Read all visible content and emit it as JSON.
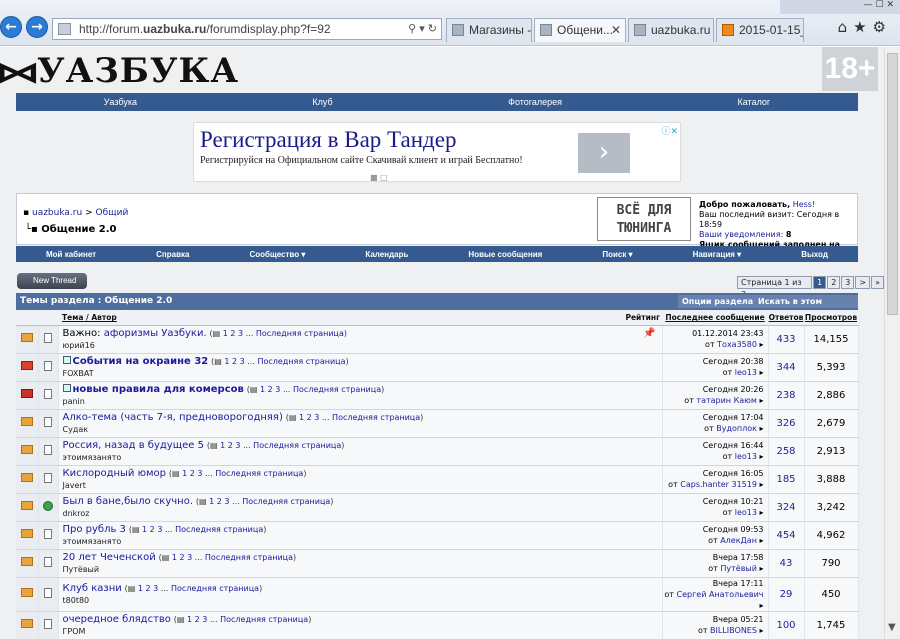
{
  "browser": {
    "url_host_prefix": "http://forum.",
    "url_host": "uazbuka.ru",
    "url_path": "/forumdisplay.php?f=92",
    "tabs": [
      {
        "label": "Магазины -..."
      },
      {
        "label": "Общени..."
      },
      {
        "label": "uazbuka.ru ..."
      },
      {
        "label": "2015-01-15_..."
      }
    ]
  },
  "site": {
    "logo": "УАЗБУКА",
    "age_badge": "18+",
    "top_nav": [
      "Уазбука",
      "Клуб",
      "Фотогалерея",
      "Каталог"
    ]
  },
  "ad": {
    "headline": "Регистрация в Вар Тандер",
    "subline": "Регистрируйся на Официальном сайте Скачивай клиент и играй Бесплатно!",
    "go": "›"
  },
  "breadcrumb": {
    "home": "uazbuka.ru",
    "sep": ">",
    "parent": "Общий",
    "current": "Общение 2.0"
  },
  "side_ad": {
    "line1": "ВСЁ ДЛЯ",
    "line2": "ТЮНИНГА"
  },
  "welcome": {
    "greet": "Добро пожаловать,",
    "user": "Hess!",
    "last_visit": "Ваш последний визит: Сегодня в 18:59",
    "notifications": "Ваши уведомления:",
    "notif_count": "8",
    "inbox": "Ящик сообщений заполнен на 98%."
  },
  "main_nav": [
    "Мой кабинет",
    "Справка",
    "Сообщество ▾",
    "Календарь",
    "Новые сообщения",
    "Поиск ▾",
    "Навигация ▾",
    "Выход"
  ],
  "new_thread": "New Thread",
  "pager": {
    "label": "Страница 1 из 3",
    "pages": [
      "1",
      "2",
      "3"
    ],
    "next": ">",
    "last": "»"
  },
  "section": {
    "title": "Темы раздела : Общение 2.0",
    "options": "Опции раздела ▾",
    "search": "Искать в этом разделе ▾"
  },
  "columns": {
    "title": "Тема",
    "slash": " / ",
    "author": "Автор",
    "rating": "Рейтинг",
    "last_post": "Последнее сообщение",
    "replies": "Ответов",
    "views": "Просмотров"
  },
  "last_page_label": "Последняя страница",
  "threads": [
    {
      "prefix": "Важно: ",
      "title": "афоризмы Уазбуки.",
      "pages": "1 2 3",
      "author": "юрий16",
      "when": "01.12.2014 23:43",
      "by": "Тоха3580",
      "replies": "433",
      "views": "14,155",
      "bold": false,
      "check": false,
      "pinned": true
    },
    {
      "prefix": "",
      "title": "События на окраине 32",
      "pages": "1 2 3",
      "author": "FOXBAT",
      "when": "Сегодня 20:38",
      "by": "leo13",
      "replies": "344",
      "views": "5,393",
      "bold": true,
      "check": true,
      "pinned": false
    },
    {
      "prefix": "",
      "title": "новые правила для комерсов",
      "pages": "1 2 3",
      "author": "panin",
      "when": "Сегодня 20:26",
      "by": "татарин Каюм",
      "replies": "238",
      "views": "2,886",
      "bold": true,
      "check": true,
      "pinned": false
    },
    {
      "prefix": "",
      "title": "Алко-тема (часть 7-я, предноворогодняя)",
      "pages": "1 2 3",
      "author": "Судак",
      "when": "Сегодня 17:04",
      "by": "Вудоплок",
      "replies": "326",
      "views": "2,679",
      "bold": false,
      "check": false,
      "pinned": false
    },
    {
      "prefix": "",
      "title": "Россия, назад в будущее 5",
      "pages": "1 2 3",
      "author": "этоимязанято",
      "when": "Сегодня 16:44",
      "by": "leo13",
      "replies": "258",
      "views": "2,913",
      "bold": false,
      "check": false,
      "pinned": false
    },
    {
      "prefix": "",
      "title": "Кислородный юмор",
      "pages": "1 2 3",
      "author": "Javert",
      "when": "Сегодня 16:05",
      "by": "Caps.hanter 31519",
      "replies": "185",
      "views": "3,888",
      "bold": false,
      "check": false,
      "pinned": false
    },
    {
      "prefix": "",
      "title": "Был в бане,было скучно.",
      "pages": "1 2 3",
      "author": "dnkroz",
      "when": "Сегодня 10:21",
      "by": "leo13",
      "replies": "324",
      "views": "3,242",
      "bold": false,
      "check": false,
      "pinned": false
    },
    {
      "prefix": "",
      "title": "Про рубль 3",
      "pages": "1 2 3",
      "author": "этоимязанято",
      "when": "Сегодня 09:53",
      "by": "АлекДан",
      "replies": "454",
      "views": "4,962",
      "bold": false,
      "check": false,
      "pinned": false
    },
    {
      "prefix": "",
      "title": "20 лет Чеченской",
      "pages": "1 2 3",
      "author": "Путёвый",
      "when": "Вчера 17:58",
      "by": "Путёвый",
      "replies": "43",
      "views": "790",
      "bold": false,
      "check": false,
      "pinned": false
    },
    {
      "prefix": "",
      "title": "Клуб казни",
      "pages": "1 2 3",
      "author": "t80t80",
      "when": "Вчера 17:11",
      "by": "Сергей Анатольевич",
      "replies": "29",
      "views": "450",
      "bold": false,
      "check": false,
      "pinned": false
    },
    {
      "prefix": "",
      "title": "очередное блядство",
      "pages": "1 2 3",
      "author": "ГРОМ",
      "when": "Вчера 05:21",
      "by": "BILLIBONES",
      "replies": "100",
      "views": "1,745",
      "bold": false,
      "check": false,
      "pinned": false
    }
  ],
  "from_label": "от"
}
